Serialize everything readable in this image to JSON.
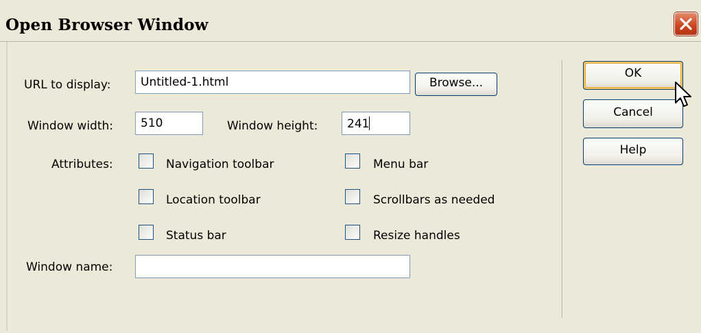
{
  "window": {
    "title": "Open Browser Window"
  },
  "form": {
    "url_label": "URL to display:",
    "url_value": "Untitled-1.html",
    "browse_label": "Browse...",
    "width_label": "Window width:",
    "width_value": "510",
    "height_label": "Window height:",
    "height_value": "241",
    "attributes_label": "Attributes:",
    "attributes": [
      {
        "label": "Navigation toolbar",
        "checked": false
      },
      {
        "label": "Menu bar",
        "checked": false
      },
      {
        "label": "Location toolbar",
        "checked": false
      },
      {
        "label": "Scrollbars as needed",
        "checked": false
      },
      {
        "label": "Status bar",
        "checked": false
      },
      {
        "label": "Resize handles",
        "checked": false
      }
    ],
    "name_label": "Window name:",
    "name_value": ""
  },
  "buttons": {
    "ok": "OK",
    "cancel": "Cancel",
    "help": "Help"
  },
  "icons": {
    "close": "close-icon",
    "cursor": "mouse-pointer-icon"
  },
  "colors": {
    "dialog_background": "#ece9d8",
    "close_button": "#c9421d",
    "input_border": "#7f9db9",
    "default_button_highlight": "#f7c55e"
  }
}
